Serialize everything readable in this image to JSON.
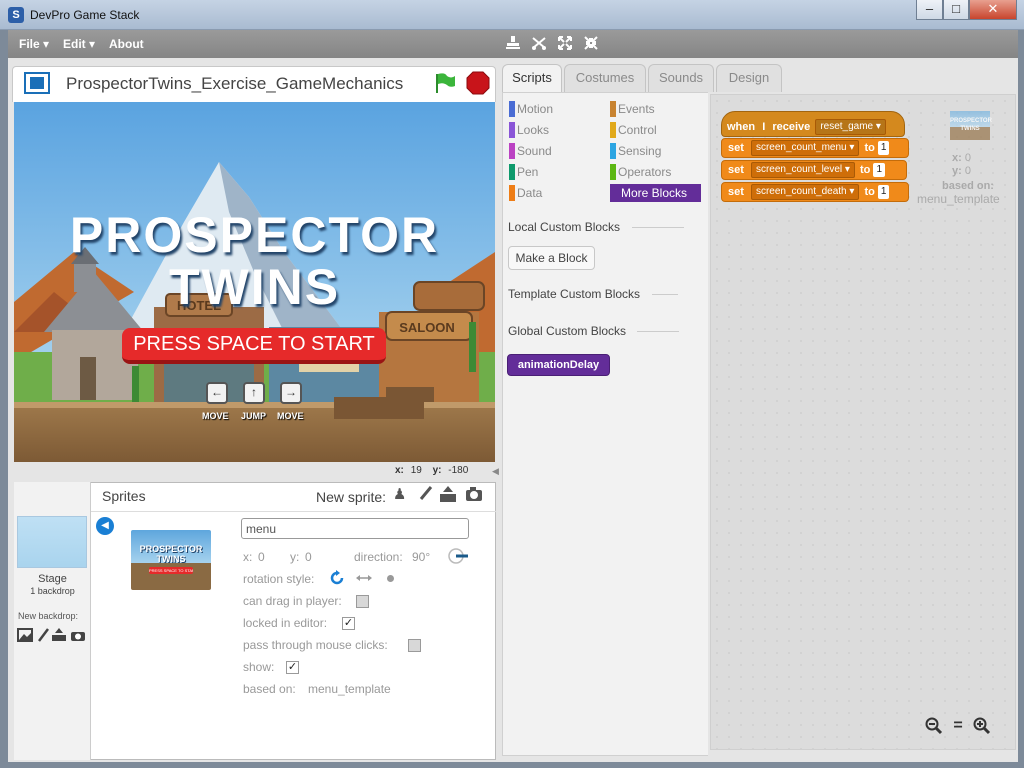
{
  "window": {
    "title": "DevPro Game Stack",
    "app_icon": "S",
    "minimize": "–",
    "maximize": "□",
    "close": "✕"
  },
  "menubar": {
    "file": "File ▾",
    "edit": "Edit ▾",
    "about": "About",
    "tools": [
      "stamp-icon",
      "cut-icon",
      "grow-icon",
      "shrink-icon"
    ]
  },
  "stage": {
    "project_title": "ProspectorTwins_Exercise_GameMechanics",
    "game_title_1": "PROSPECTOR",
    "game_title_2": "TWINS",
    "start_prompt": "PRESS SPACE TO START",
    "sign_hotel": "HOTEL",
    "sign_saloon": "SALOON",
    "controls": [
      {
        "key": "←",
        "label": "MOVE"
      },
      {
        "key": "↑",
        "label": "JUMP"
      },
      {
        "key": "→",
        "label": "MOVE"
      }
    ],
    "x_label": "x:",
    "x_value": "19",
    "y_label": "y:",
    "y_value": "-180"
  },
  "sprites_panel": {
    "title": "Sprites",
    "new_sprite_label": "New sprite:",
    "stage_label": "Stage",
    "stage_backdrops": "1 backdrop",
    "new_backdrop_label": "New backdrop:",
    "thumb_line1": "PROSPECTOR",
    "thumb_line2": "TWINS",
    "thumb_line3": "PRESS SPACE TO START",
    "sprite_name": "menu",
    "x_label": "x:",
    "x_value": "0",
    "y_label": "y:",
    "y_value": "0",
    "direction_label": "direction:",
    "direction_value": "90°",
    "rotation_label": "rotation style:",
    "can_drag_label": "can drag in player:",
    "locked_label": "locked in editor:",
    "pass_through_label": "pass through mouse clicks:",
    "show_label": "show:",
    "based_on_label": "based on:",
    "based_on_value": "menu_template"
  },
  "tabs": [
    "Scripts",
    "Costumes",
    "Sounds",
    "Design"
  ],
  "categories": [
    {
      "name": "Motion",
      "color": "#4a6cd4"
    },
    {
      "name": "Events",
      "color": "#c88330"
    },
    {
      "name": "Looks",
      "color": "#8a55d7"
    },
    {
      "name": "Control",
      "color": "#e1a91a"
    },
    {
      "name": "Sound",
      "color": "#bb42c3"
    },
    {
      "name": "Sensing",
      "color": "#2ca5e2"
    },
    {
      "name": "Pen",
      "color": "#0e9a6c"
    },
    {
      "name": "Operators",
      "color": "#5cb712"
    },
    {
      "name": "Data",
      "color": "#ee7d16"
    },
    {
      "name": "More Blocks",
      "color": "#632d99"
    }
  ],
  "palette": {
    "local_header": "Local Custom Blocks",
    "make_block": "Make a Block",
    "template_header": "Template Custom Blocks",
    "global_header": "Global Custom Blocks",
    "global_block": "animationDelay"
  },
  "script": {
    "hat_when": "when",
    "hat_i": "I",
    "hat_receive": "receive",
    "hat_message": "reset_game",
    "set_word": "set",
    "to_word": "to",
    "sets": [
      {
        "var": "screen_count_menu",
        "value": "1"
      },
      {
        "var": "screen_count_level",
        "value": "1"
      },
      {
        "var": "screen_count_death",
        "value": "1"
      }
    ]
  },
  "sprite_info": {
    "thumb_text": "PROSPECTOR TWINS",
    "x_label": "x:",
    "x_value": "0",
    "y_label": "y:",
    "y_value": "0",
    "based_on_label": "based on:",
    "based_on_value": "menu_template"
  },
  "zoom": {
    "out": "−",
    "reset": "=",
    "in": "+"
  }
}
